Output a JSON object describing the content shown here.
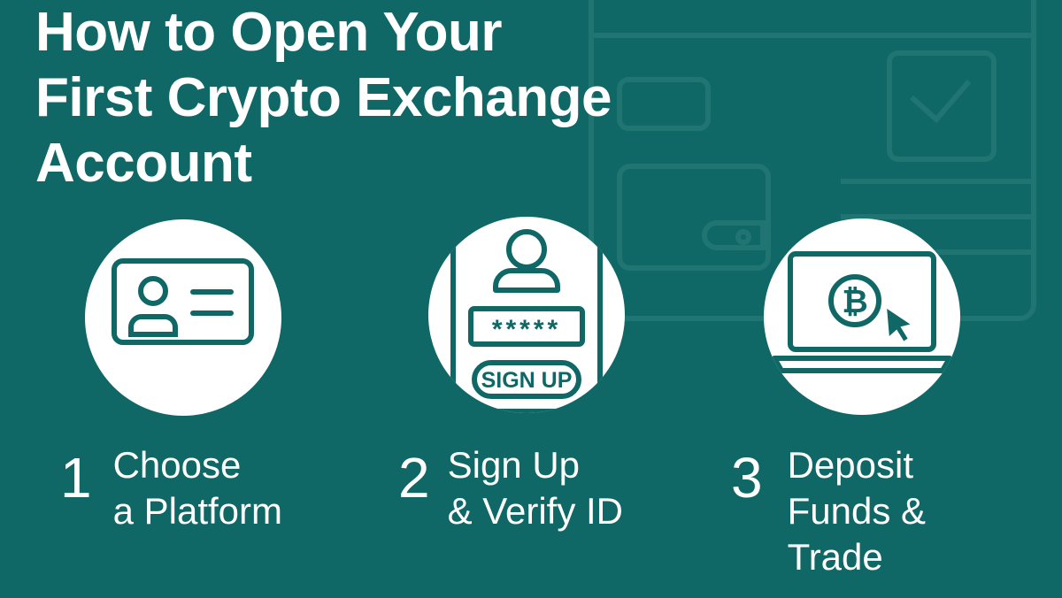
{
  "title_lines": [
    "How to Open Your",
    "First Crypto Exchange",
    "Account"
  ],
  "steps": [
    {
      "number": "1",
      "lines": [
        "Choose",
        "a Platform"
      ],
      "icon": "id-card-icon"
    },
    {
      "number": "2",
      "lines": [
        "Sign Up",
        "& Verify ID"
      ],
      "icon": "signup-form-icon",
      "password_mask": "*****",
      "button_label": "SIGN UP"
    },
    {
      "number": "3",
      "lines": [
        "Deposit",
        "Funds &",
        "Trade"
      ],
      "icon": "laptop-bitcoin-icon",
      "coin_symbol": "₿"
    }
  ],
  "colors": {
    "background": "#0f6766",
    "foreground": "#ffffff",
    "accent": "#0f6766"
  }
}
